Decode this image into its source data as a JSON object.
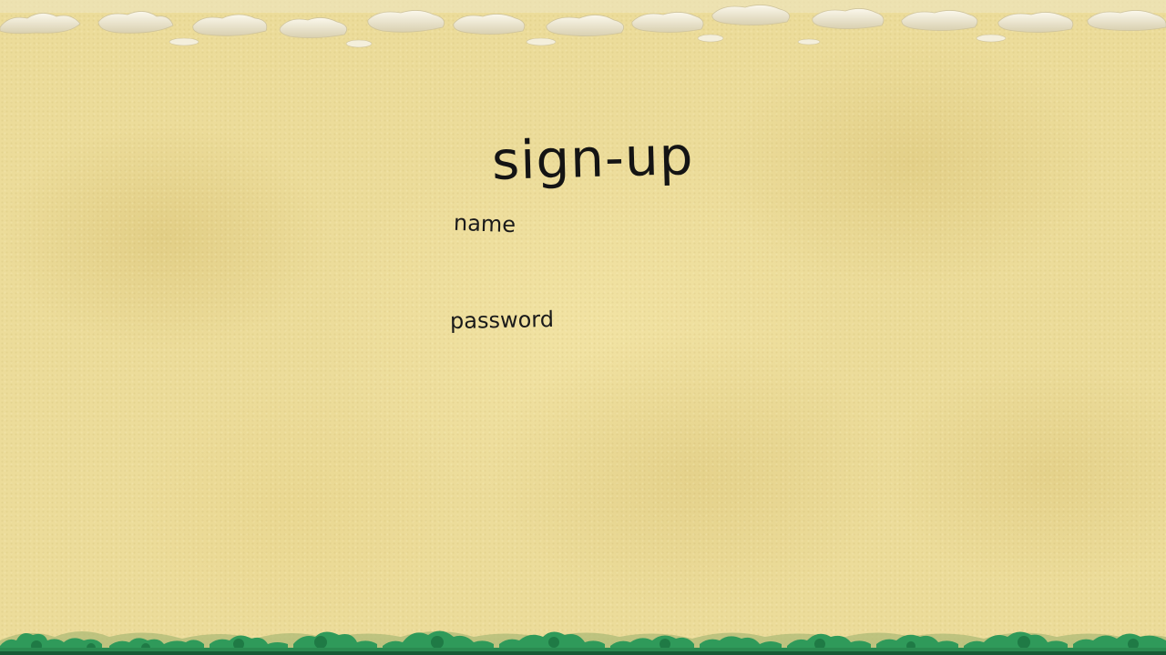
{
  "page": {
    "title": "sign-up"
  },
  "form": {
    "name_label": "name",
    "name_value": "",
    "password_label": "password",
    "password_value": ""
  },
  "decor": {
    "top": "clouds-border",
    "bottom": "treeline-border",
    "background": "parchment-texture"
  },
  "colors": {
    "background": "#ecdc9a",
    "text": "#141414",
    "cloud": "#f3eedc",
    "tree_dark": "#1f7a45",
    "tree_light": "#2f9a5a",
    "ground": "#165a35"
  }
}
